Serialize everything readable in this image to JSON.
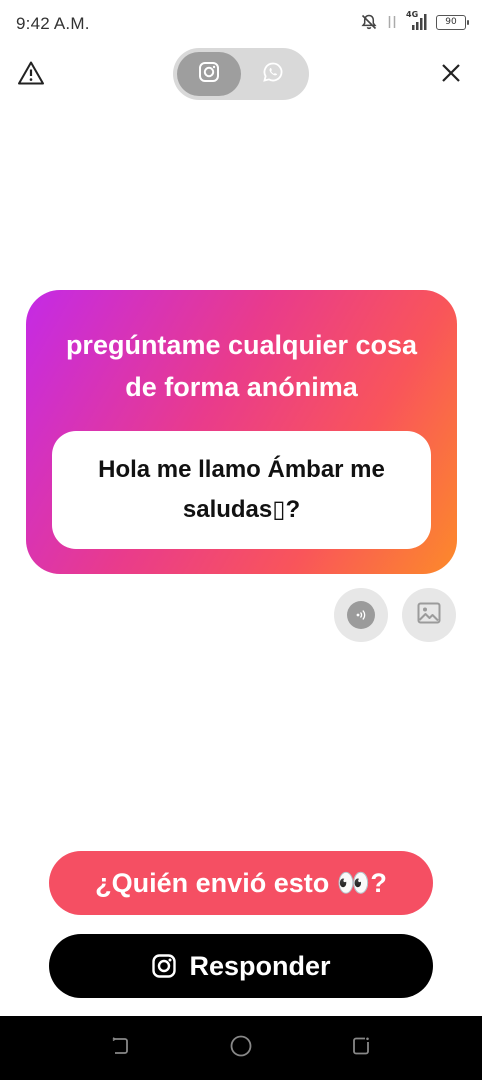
{
  "status_bar": {
    "time": "9:42 A.M.",
    "network_label": "4G",
    "battery_level": "90",
    "icons": [
      "bell-muted-icon",
      "data-arrows-icon",
      "signal-icon",
      "battery-icon"
    ]
  },
  "top_bar": {
    "warning_icon": "warning-triangle-icon",
    "close_icon": "close-x-icon",
    "toggle": {
      "options": [
        {
          "icon": "instagram-icon",
          "active": true
        },
        {
          "icon": "whatsapp-icon",
          "active": false
        }
      ]
    }
  },
  "card": {
    "title": "pregúntame cualquier cosa de forma anónima",
    "question": "Hola me llamo Ámbar me saludas▯?",
    "gradient_colors": [
      "#c42ae6",
      "#e93b8c",
      "#f9555a",
      "#fc8a2a"
    ]
  },
  "actions": {
    "sound_icon": "sound-wave-icon",
    "image_icon": "image-icon"
  },
  "buttons": {
    "who_sent": "¿Quién envió esto 👀?",
    "reply": "Responder",
    "reply_icon": "instagram-icon",
    "who_sent_color": "#f54f63",
    "reply_color": "#000000"
  },
  "nav_bar": {
    "icons": [
      "back-icon",
      "home-icon",
      "recent-apps-icon"
    ]
  }
}
